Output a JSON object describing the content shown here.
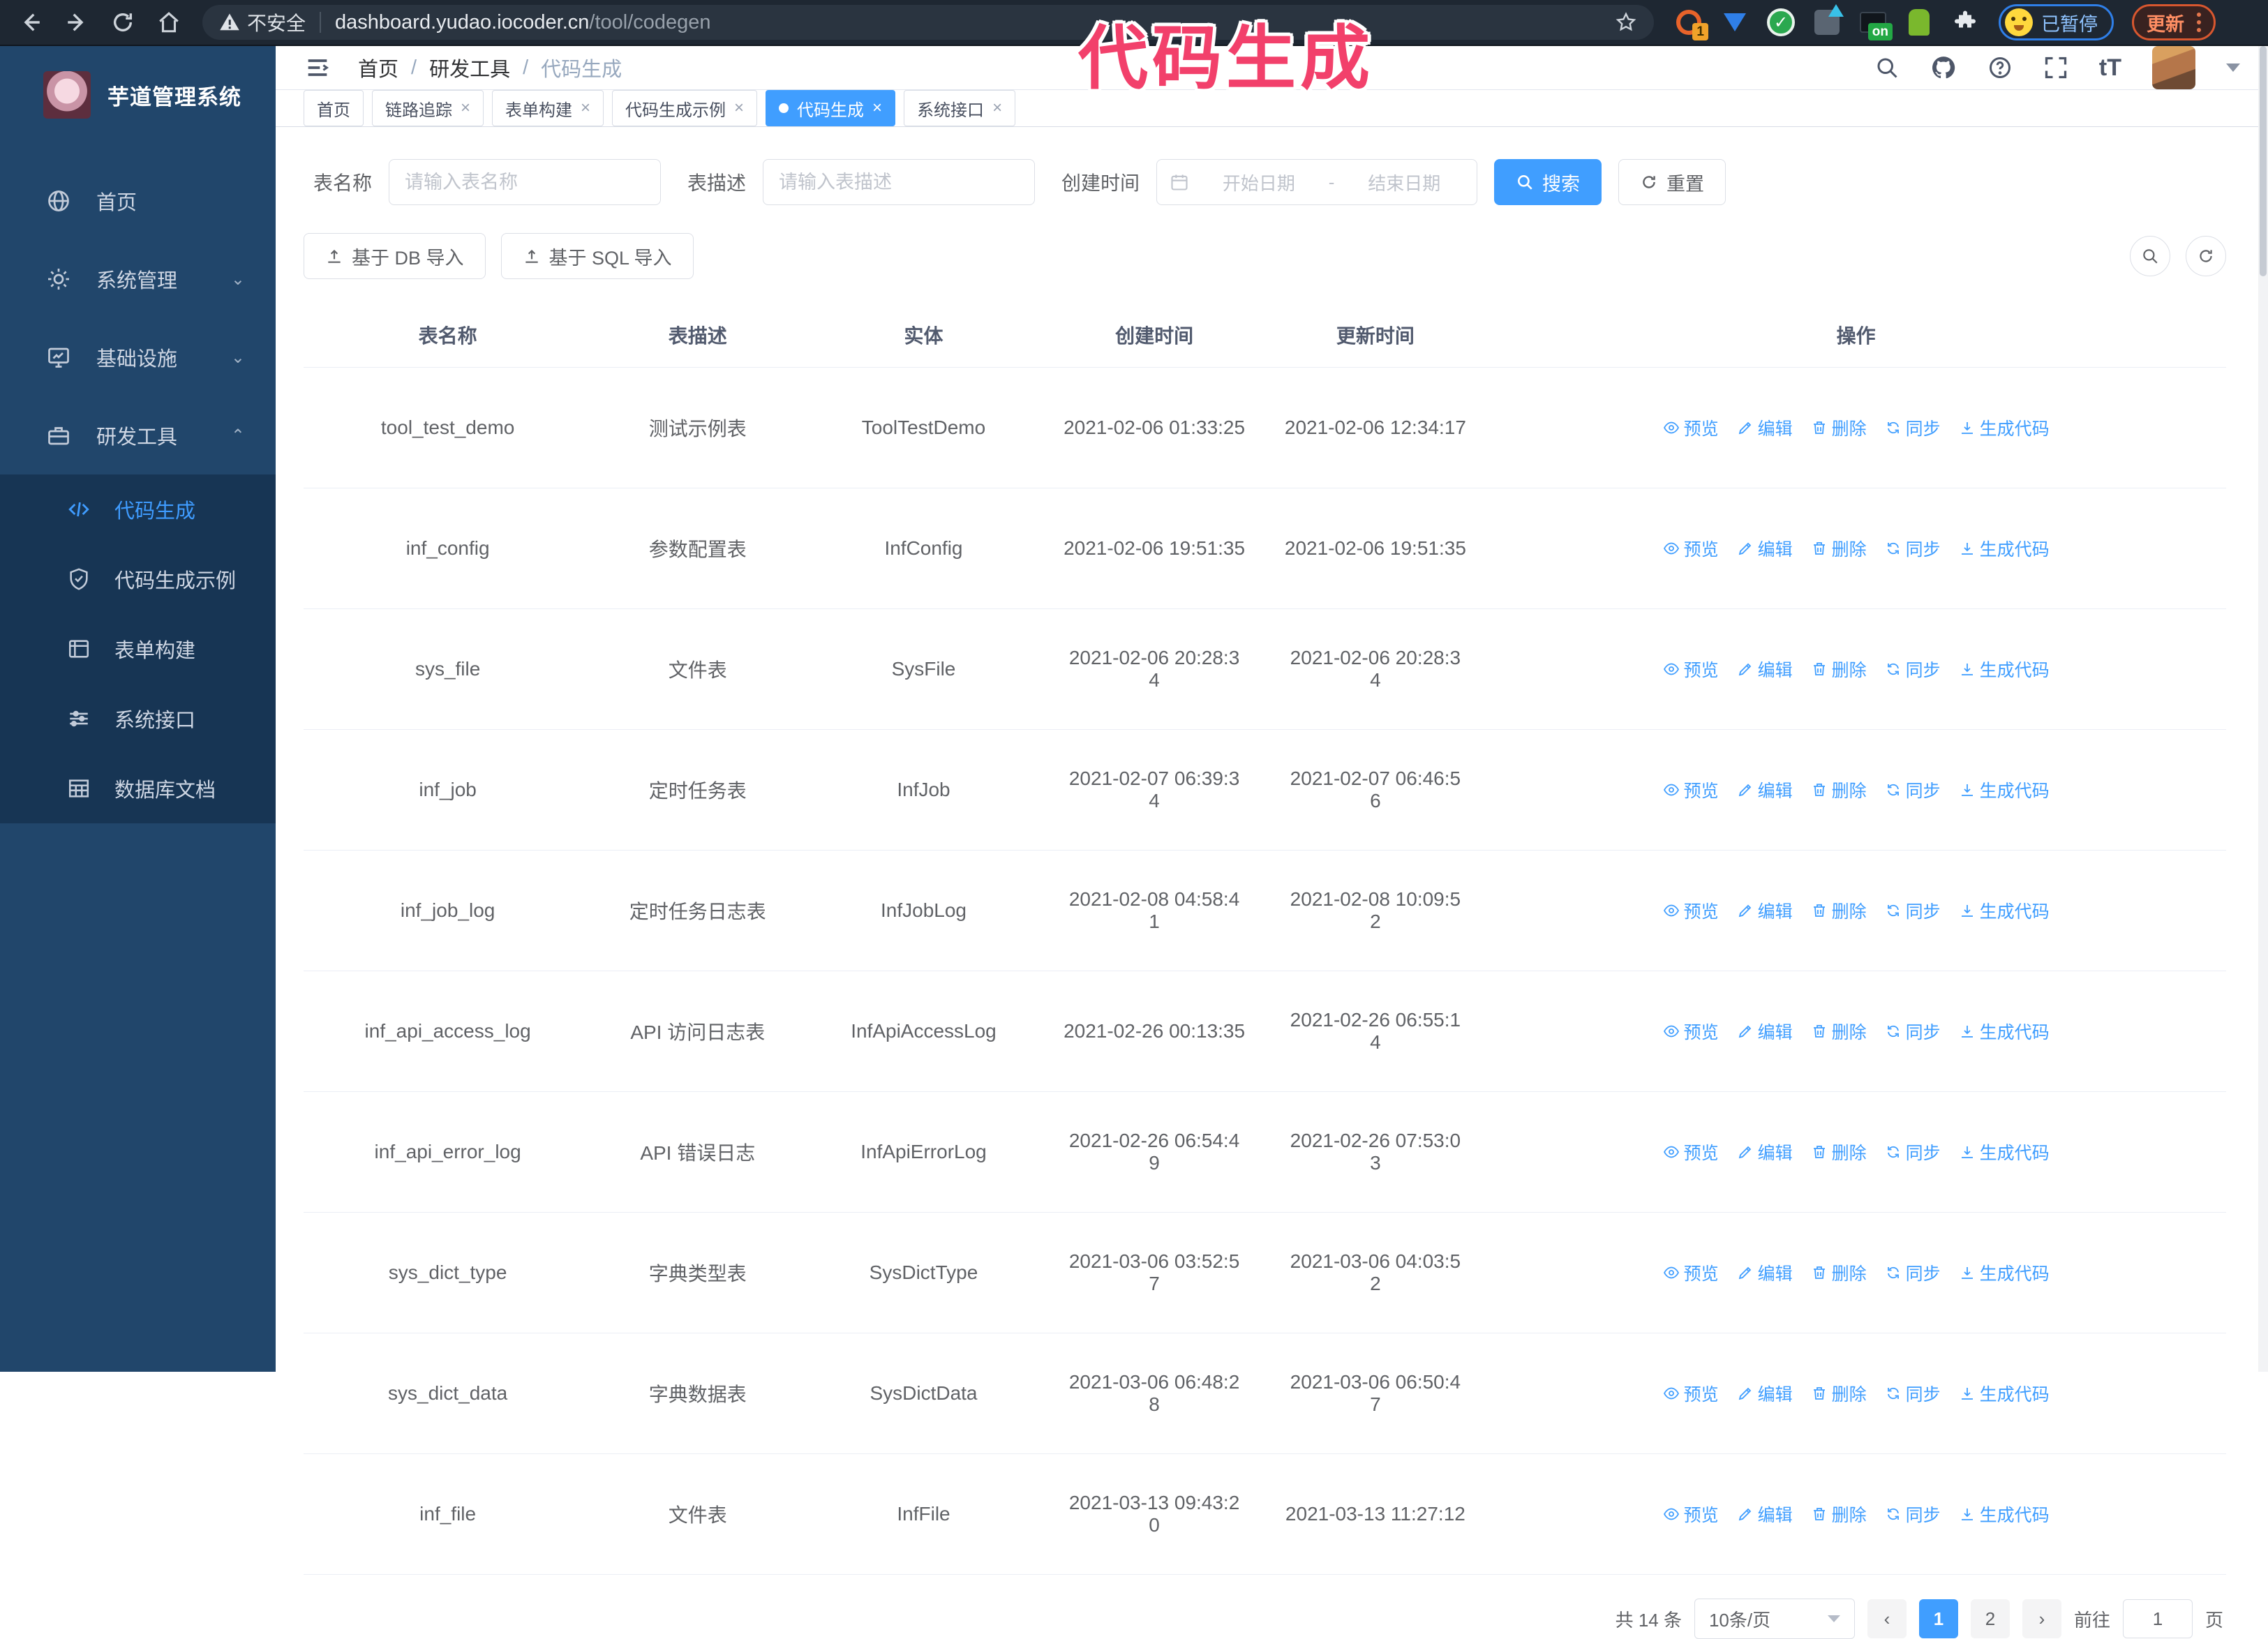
{
  "browser": {
    "security_label": "不安全",
    "url_host": "dashboard.yudao.iocoder.cn",
    "url_path": "/tool/codegen",
    "ext_badge_count": "1",
    "ext_badge_on": "on",
    "paused_label": "已暂停",
    "update_label": "更新"
  },
  "overlay": {
    "title": "代码生成",
    "color": "#f2406b"
  },
  "sidebar": {
    "logo_title": "芋道管理系统",
    "items": [
      {
        "label": "首页"
      },
      {
        "label": "系统管理"
      },
      {
        "label": "基础设施"
      },
      {
        "label": "研发工具"
      }
    ],
    "subitems": [
      {
        "label": "代码生成"
      },
      {
        "label": "代码生成示例"
      },
      {
        "label": "表单构建"
      },
      {
        "label": "系统接口"
      },
      {
        "label": "数据库文档"
      }
    ]
  },
  "header": {
    "breadcrumb": [
      "首页",
      "研发工具",
      "代码生成"
    ]
  },
  "tabs": [
    {
      "label": "首页"
    },
    {
      "label": "链路追踪"
    },
    {
      "label": "表单构建"
    },
    {
      "label": "代码生成示例"
    },
    {
      "label": "代码生成"
    },
    {
      "label": "系统接口"
    }
  ],
  "filters": {
    "name_label": "表名称",
    "name_placeholder": "请输入表名称",
    "desc_label": "表描述",
    "desc_placeholder": "请输入表描述",
    "time_label": "创建时间",
    "start_placeholder": "开始日期",
    "range_sep": "-",
    "end_placeholder": "结束日期",
    "search_label": "搜索",
    "reset_label": "重置"
  },
  "toolbar": {
    "db_import_label": "基于 DB 导入",
    "sql_import_label": "基于 SQL 导入"
  },
  "table": {
    "columns": [
      "表名称",
      "表描述",
      "实体",
      "创建时间",
      "更新时间",
      "操作"
    ],
    "action_labels": {
      "preview": "预览",
      "edit": "编辑",
      "delete": "删除",
      "sync": "同步",
      "generate": "生成代码"
    },
    "rows": [
      {
        "name": "tool_test_demo",
        "desc": "测试示例表",
        "entity": "ToolTestDemo",
        "created": "2021-02-06 01:33:25",
        "updated": "2021-02-06 12:34:17"
      },
      {
        "name": "inf_config",
        "desc": "参数配置表",
        "entity": "InfConfig",
        "created": "2021-02-06 19:51:35",
        "updated": "2021-02-06 19:51:35"
      },
      {
        "name": "sys_file",
        "desc": "文件表",
        "entity": "SysFile",
        "created": "2021-02-06 20:28:3\n4",
        "updated": "2021-02-06 20:28:3\n4"
      },
      {
        "name": "inf_job",
        "desc": "定时任务表",
        "entity": "InfJob",
        "created": "2021-02-07 06:39:3\n4",
        "updated": "2021-02-07 06:46:5\n6"
      },
      {
        "name": "inf_job_log",
        "desc": "定时任务日志表",
        "entity": "InfJobLog",
        "created": "2021-02-08 04:58:4\n1",
        "updated": "2021-02-08 10:09:5\n2"
      },
      {
        "name": "inf_api_access_log",
        "desc": "API 访问日志表",
        "entity": "InfApiAccessLog",
        "created": "2021-02-26 00:13:35",
        "updated": "2021-02-26 06:55:1\n4"
      },
      {
        "name": "inf_api_error_log",
        "desc": "API 错误日志",
        "entity": "InfApiErrorLog",
        "created": "2021-02-26 06:54:4\n9",
        "updated": "2021-02-26 07:53:0\n3"
      },
      {
        "name": "sys_dict_type",
        "desc": "字典类型表",
        "entity": "SysDictType",
        "created": "2021-03-06 03:52:5\n7",
        "updated": "2021-03-06 04:03:5\n2"
      },
      {
        "name": "sys_dict_data",
        "desc": "字典数据表",
        "entity": "SysDictData",
        "created": "2021-03-06 06:48:2\n8",
        "updated": "2021-03-06 06:50:4\n7"
      },
      {
        "name": "inf_file",
        "desc": "文件表",
        "entity": "InfFile",
        "created": "2021-03-13 09:43:2\n0",
        "updated": "2021-03-13 11:27:12"
      }
    ]
  },
  "pagination": {
    "total": "共 14 条",
    "page_size": "10条/页",
    "pages": [
      "1",
      "2"
    ],
    "goto_label": "前往",
    "goto_value": "1",
    "page_suffix": "页"
  }
}
